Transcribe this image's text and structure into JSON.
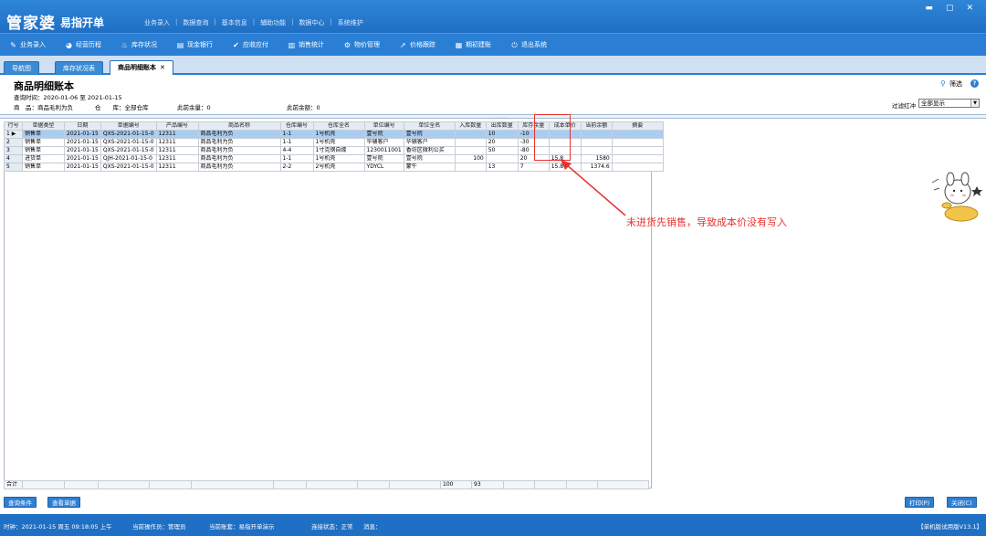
{
  "app": {
    "logo_main": "管家婆",
    "logo_sub": "易指开单",
    "top_menu": [
      "业务录入",
      "数据查询",
      "基本信息",
      "辅助功能",
      "数据中心",
      "系统维护"
    ],
    "window_controls": [
      "▬",
      "▢",
      "✕"
    ]
  },
  "toolbar": [
    {
      "label": "业务录入",
      "icon": "pen-icon",
      "glyph": "✎"
    },
    {
      "label": "经营历程",
      "icon": "pie-icon",
      "glyph": "◕"
    },
    {
      "label": "库存状况",
      "icon": "flame-icon",
      "glyph": "♨"
    },
    {
      "label": "现金银行",
      "icon": "bank-icon",
      "glyph": "▤"
    },
    {
      "label": "应收应付",
      "icon": "check-icon",
      "glyph": "✔"
    },
    {
      "label": "销售统计",
      "icon": "bar-chart-icon",
      "glyph": "▥"
    },
    {
      "label": "物价管理",
      "icon": "gear-icon",
      "glyph": "⚙"
    },
    {
      "label": "价格跟踪",
      "icon": "arrow-icon",
      "glyph": "➚"
    },
    {
      "label": "期初建账",
      "icon": "book-icon",
      "glyph": "▦"
    },
    {
      "label": "退出系统",
      "icon": "power-icon",
      "glyph": "⏻"
    }
  ],
  "tabs": [
    {
      "label": "导航图"
    },
    {
      "label": "库存状况表"
    },
    {
      "label": "商品明细账本",
      "close": "✕"
    }
  ],
  "header": {
    "title": "商品明细账本",
    "query_time": "查询时间：2020-01-06 至 2021-01-15",
    "product": "商　品：商品毛利为负",
    "warehouse": "仓　　库：全部仓库",
    "prev_balance": "此前余量：0",
    "prev_amount": "此前余额：0",
    "filter_button": "筛选",
    "filter_label": "过滤红冲",
    "filter_value": "全部显示"
  },
  "grid": {
    "columns": [
      "行号",
      "单据类型",
      "日期",
      "单据编号",
      "产品编号",
      "商品名称",
      "仓库编号",
      "仓库全名",
      "单位编号",
      "单位全名",
      "入库数量",
      "出库数量",
      "库存余量",
      "成本单价",
      "当前余额",
      "摘要"
    ],
    "rows": [
      [
        "1 ▶",
        "销售单",
        "2021-01-15",
        "QXS-2021-01-15-0",
        "12311",
        "商品毛利为负",
        "1-1",
        "1号机壳",
        "壹号院",
        "壹号院",
        "",
        "10",
        "-10",
        "",
        "",
        ""
      ],
      [
        "2",
        "销售单",
        "2021-01-15",
        "QXS-2021-01-15-0",
        "12311",
        "商品毛利为负",
        "1-1",
        "1号机壳",
        "华辅客户",
        "华辅客户",
        "",
        "20",
        "-30",
        "",
        "",
        ""
      ],
      [
        "3",
        "销售单",
        "2021-01-15",
        "QXS-2021-01-15-0",
        "12311",
        "商品毛利为负",
        "4-4",
        "1寸克钢自缘",
        "1230011001",
        "香坊区微利公买",
        "",
        "50",
        "-80",
        "",
        "",
        ""
      ],
      [
        "4",
        "进货单",
        "2021-01-15",
        "QJH-2021-01-15-0",
        "12311",
        "商品毛利为负",
        "1-1",
        "1号机壳",
        "壹号院",
        "壹号院",
        "100",
        "",
        "20",
        "15.8",
        "1580",
        ""
      ],
      [
        "5",
        "销售单",
        "2021-01-15",
        "QXS-2021-01-15-0",
        "12311",
        "商品毛利为负",
        "2-2",
        "2号机壳",
        "YDYCL",
        "蒙牛",
        "",
        "13",
        "7",
        "15.8",
        "1374.6",
        ""
      ]
    ],
    "summary_label": "合计",
    "summary_in": "100",
    "summary_out": "93"
  },
  "annotation": {
    "text": "未进货先销售，导致成本价没有写入",
    "color": "#e8322e"
  },
  "buttons": {
    "query_condition": "查询条件",
    "view_document": "查看单据",
    "print": "打印(P)",
    "close": "关闭(C)"
  },
  "status": {
    "time": "时钟：2021-01-15 周五 09:18:05 上午",
    "operator": "当前操作员：管理员",
    "account": "当前账套：易指开单演示",
    "conn": "连接状态：正常",
    "msg": "消息：",
    "version": "【单机版试用版V13.1】"
  },
  "colors": {
    "brand": "#2a7fd4",
    "selected_row": "#a9cdf2"
  }
}
